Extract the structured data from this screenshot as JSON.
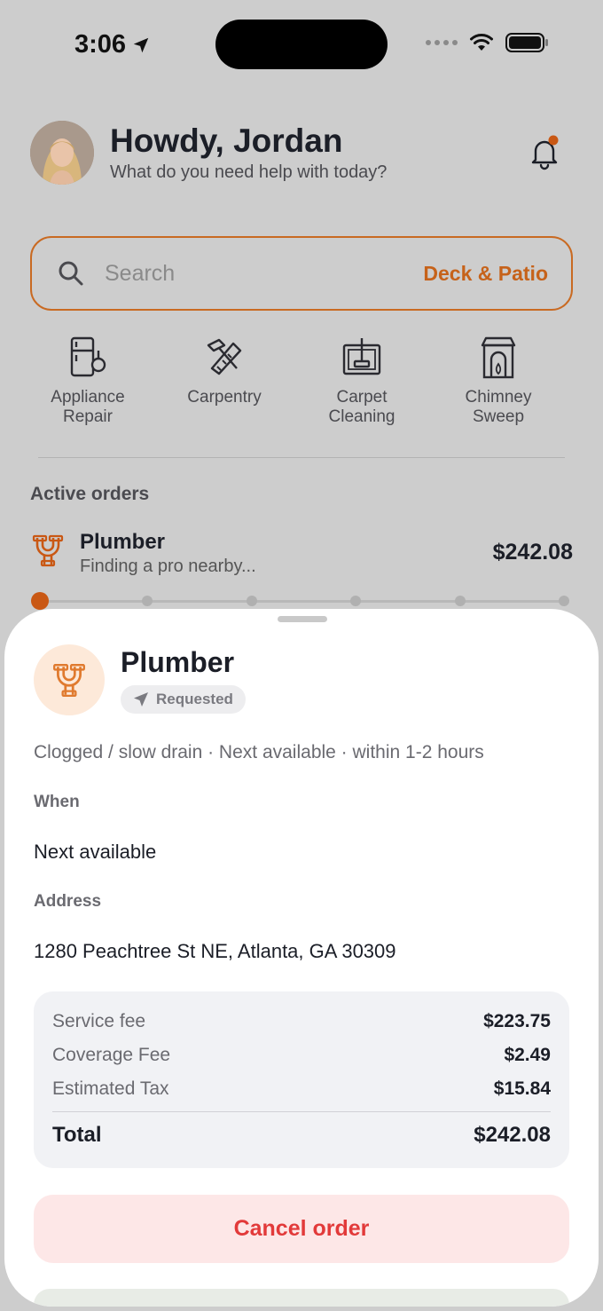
{
  "status_bar": {
    "time": "3:06"
  },
  "header": {
    "greeting": "Howdy, Jordan",
    "subtitle": "What do you need help with today?"
  },
  "search": {
    "placeholder": "Search",
    "suggestion": "Deck & Patio"
  },
  "categories": [
    {
      "line1": "Appliance",
      "line2": "Repair",
      "icon": "appliance-repair-icon"
    },
    {
      "line1": "Carpentry",
      "line2": "",
      "icon": "carpentry-icon"
    },
    {
      "line1": "Carpet",
      "line2": "Cleaning",
      "icon": "carpet-cleaning-icon"
    },
    {
      "line1": "Chimney",
      "line2": "Sweep",
      "icon": "chimney-sweep-icon"
    }
  ],
  "active_orders": {
    "title": "Active orders",
    "order": {
      "service": "Plumber",
      "status_text": "Finding a pro nearby...",
      "price": "$242.08",
      "progress_step": 1,
      "progress_steps_total": 6
    }
  },
  "sheet": {
    "service": "Plumber",
    "status": "Requested",
    "details": "Clogged / slow drain · Next available · within 1-2 hours",
    "when_label": "When",
    "when_value": "Next available",
    "address_label": "Address",
    "address_value": "1280 Peachtree St NE, Atlanta, GA 30309",
    "fees": [
      {
        "name": "Service fee",
        "amount": "$223.75"
      },
      {
        "name": "Coverage Fee",
        "amount": "$2.49"
      },
      {
        "name": "Estimated Tax",
        "amount": "$15.84"
      }
    ],
    "total_label": "Total",
    "total_amount": "$242.08",
    "cancel_label": "Cancel order"
  },
  "colors": {
    "accent": "#c6621a",
    "danger": "#e23a3a",
    "danger_bg": "#fde7e7",
    "icon_bg": "#fde9d9"
  }
}
